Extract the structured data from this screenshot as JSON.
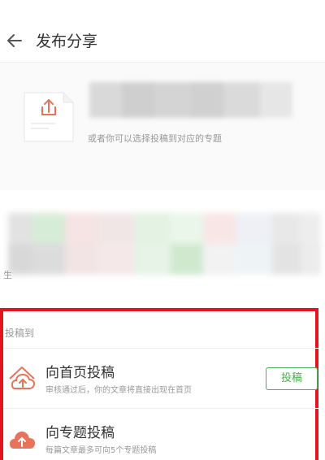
{
  "header": {
    "title": "发布分享",
    "back_icon": "arrow-left-icon"
  },
  "share_card": {
    "icon": "upload-document-icon",
    "hint": "或者你可以选择投稿到对应的专题",
    "accent_color": "#e8735a"
  },
  "middle": {
    "fragment": "生"
  },
  "submit_section": {
    "label": "投稿到",
    "options": [
      {
        "title": "向首页投稿",
        "description": "审核通过后，你的文章将直接出现在首页",
        "icon": "cloud-upload-outline-icon",
        "button_label": "投稿",
        "button_color": "#4caf50"
      },
      {
        "title": "向专题投稿",
        "description": "每篇文章最多可向5个专题投稿",
        "icon": "cloud-upload-filled-icon"
      }
    ]
  },
  "highlight_color": "#e3141e"
}
